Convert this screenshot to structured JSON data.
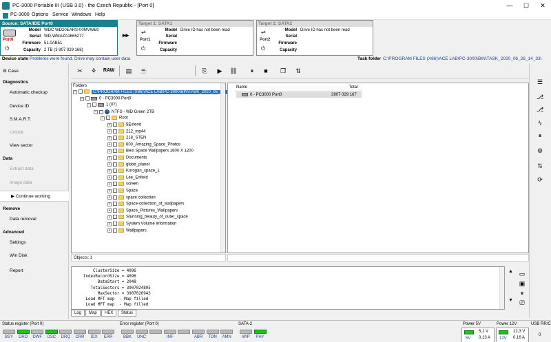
{
  "window": {
    "title": "PC-3000 Portable III (USB 3.0) - the Czech Republic - [Port 0]",
    "minimize": "—",
    "maximize": "☐",
    "close": "✕"
  },
  "menu": [
    "PC-3000",
    "Options",
    "Service",
    "Windows",
    "Help"
  ],
  "source": {
    "header": "Source: SATA/IDE Port0",
    "port_label": "Port0",
    "labels": {
      "model": "Model",
      "serial": "Serial",
      "firmware": "Firmware",
      "capacity": "Capacity"
    },
    "model": "WDC WD20EARS-00MVWB0",
    "serial": "WD-WMAZA1665277",
    "firmware": "51.0AB51",
    "capacity": "2 TB (3 907 029 168)"
  },
  "target1": {
    "header": "Target 1: SATA1",
    "port_label": "Port1",
    "model": "Drive ID has not been read",
    "labels": {
      "model": "Model",
      "serial": "Serial",
      "firmware": "Firmware",
      "capacity": "Capacity"
    }
  },
  "target2": {
    "header": "Target 2: SATA2",
    "port_label": "Port2",
    "model": "Drive ID has not been read",
    "labels": {
      "model": "Model",
      "serial": "Serial",
      "firmware": "Firmware",
      "capacity": "Capacity"
    }
  },
  "device_state": {
    "label": "Device state",
    "value": "Problems were found, Drive may contain user data",
    "task_label": "Task folder",
    "task_value": "C:\\PROGRAM FILES (X86)\\ACE LAB\\PC-3000\\BIN\\TASK_2020_06_26_14_33\\"
  },
  "sidebar": {
    "case": "Case",
    "diagnostics": "Diagnostics",
    "automatic_checkup": "Automatic checkup",
    "device_id": "Device ID",
    "smart": "S.M.A.R.T.",
    "unlock": "Unlock",
    "view_sector": "View sector",
    "data": "Data",
    "extract_data": "Extract data",
    "image_data": "Image data",
    "continue_working": "Continue working",
    "remove": "Remove",
    "data_removal": "Data removal",
    "advanced": "Advanced",
    "settings": "Settings",
    "win_disk": "Win Disk",
    "report": "Report"
  },
  "toolbar": {
    "raw_label": "RAW"
  },
  "folders": {
    "header": "Folders",
    "root_path": "C:\\PROGRAM FILES (X86)\\ACE LAB\\PC-3000\\BIN\\TASK_2020_06_26_",
    "port": "0 - PC3000 Port0",
    "partition": "1 (07)",
    "volume": "NTFS - WD Green 2TB",
    "root": "Root",
    "items": [
      "$Extend",
      "212_mp44",
      "218_STEN",
      "600_Amazing_Space_Photos",
      "Best Space Wallpapers 1600 X 1200",
      "Documents",
      "globe_planet",
      "Korogan_space_1",
      "Lee_Enfield",
      "screen",
      "Space",
      "space collection",
      "Space-collection_of_wallpapers",
      "Space_Pictures_Wallpapers",
      "Stunning_beauty_of_outer_space",
      "System Volume Information",
      "Wallpapers"
    ]
  },
  "filelist": {
    "col_name": "Name",
    "col_total": "Total",
    "rows": [
      {
        "name": "0 - PC3000 Port0",
        "total": "3907 029 167"
      }
    ]
  },
  "objects_label": "Objects: 1",
  "log": {
    "lines": [
      "      ClusterSize = 4096",
      "  IndexRecordSize = 4096",
      "        DataStart = 2048",
      "     TotalSectors = 3907024895",
      "        MaxSector = 3907026943",
      "   Load MFT map  - Map filled",
      "   Load MFT map  - Map filled"
    ],
    "tabs": [
      "Log",
      "Map",
      "HEX",
      "Status"
    ]
  },
  "status": {
    "status_register": "Status register (Port 0)",
    "status_leds": [
      {
        "name": "BSY",
        "on": false
      },
      {
        "name": "DRD",
        "on": true
      },
      {
        "name": "DWF",
        "on": false
      },
      {
        "name": "DSC",
        "on": true
      },
      {
        "name": "DRQ",
        "on": false
      },
      {
        "name": "CRR",
        "on": false
      },
      {
        "name": "IDX",
        "on": false
      },
      {
        "name": "ERR",
        "on": false
      }
    ],
    "error_register": "Error register (Port 0)",
    "error_leds": [
      "BBK",
      "UNC",
      "",
      "INF",
      "",
      "ABR",
      "TON",
      "AMN"
    ],
    "sata": "SATA-2",
    "sata_leds": [
      {
        "name": "W/P",
        "on": false
      },
      {
        "name": "PHY",
        "on": true
      }
    ],
    "power5": {
      "title": "Power 5V",
      "voltage": "5,1 V",
      "current": "0,13 A",
      "label": "5V"
    },
    "power12": {
      "title": "Power 12V",
      "voltage": "12,3 V",
      "current": "0,16 A",
      "label": "12V"
    },
    "usb": {
      "title": "USB RR/C",
      "value": "0"
    }
  }
}
